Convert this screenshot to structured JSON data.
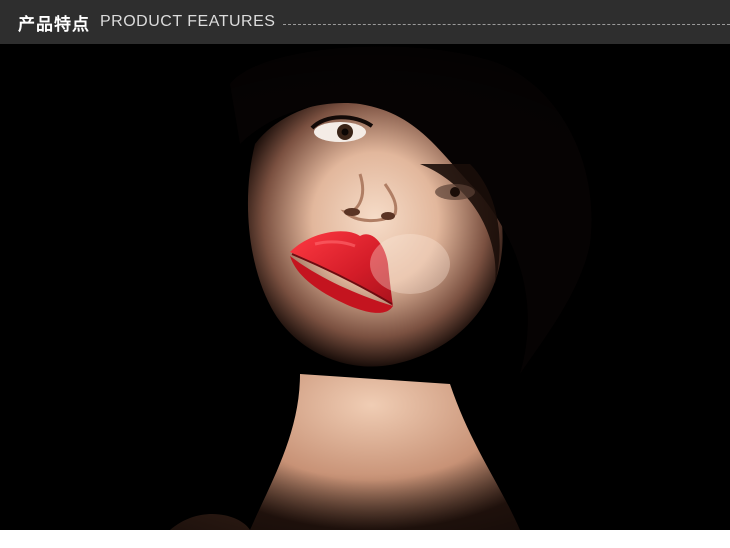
{
  "header": {
    "title_cn": "产品特点",
    "title_en": "PRODUCT FEATURES"
  },
  "hero": {
    "subject": "portrait-model-red-lips",
    "colors": {
      "background": "#000000",
      "skin": "#e8c2a8",
      "lips": "#d81e2a",
      "hair": "#0a0605"
    }
  },
  "colors": {
    "header_bg": "#2e2e2e",
    "header_text": "#ffffff",
    "header_subtext": "#dcdcdc",
    "dash": "#9a9a9a"
  }
}
